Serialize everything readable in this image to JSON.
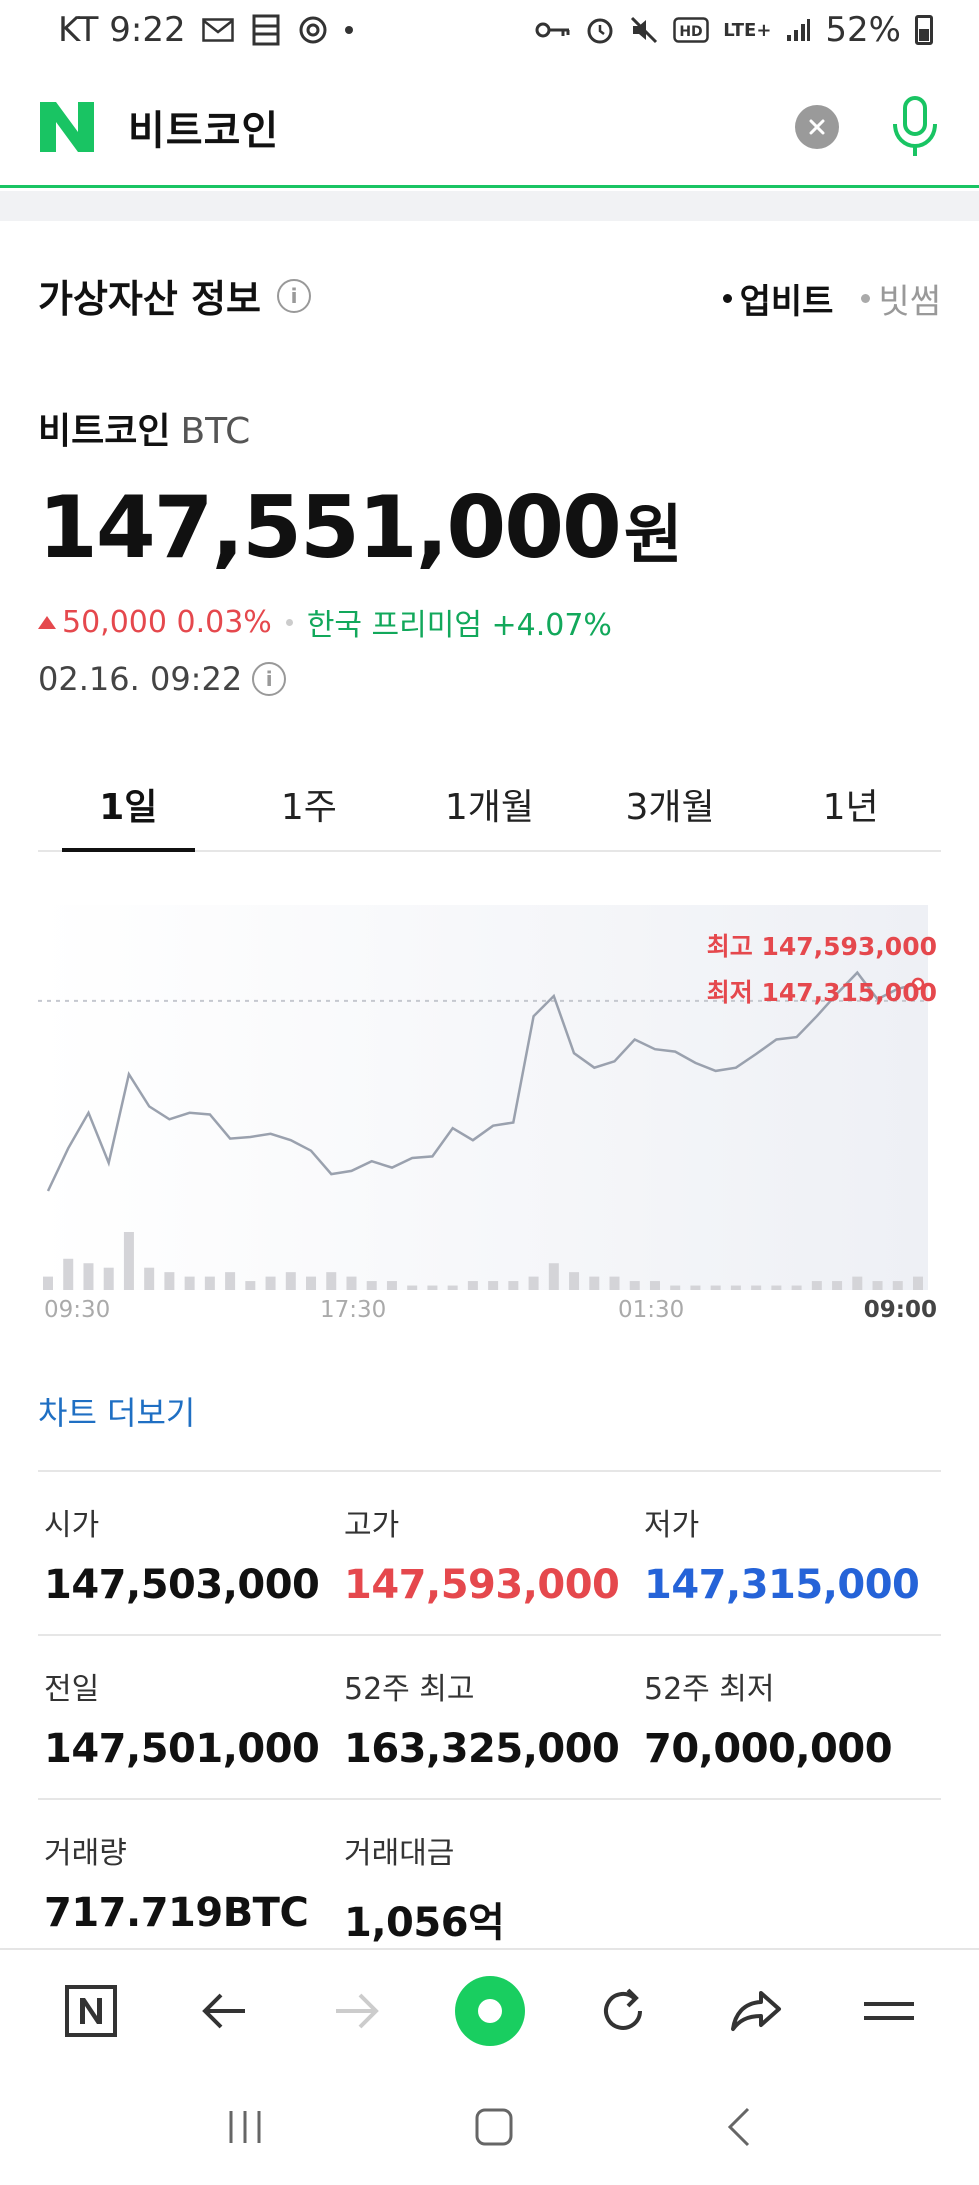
{
  "status_bar": {
    "carrier_time": "KT 9:22",
    "battery": "52%",
    "network": "LTE+",
    "icons": [
      "mail-icon",
      "gallery-icon",
      "chrome-icon",
      "dot-icon",
      "key-icon",
      "alarm-icon",
      "mute-icon",
      "hd-icon",
      "lte-icon",
      "signal-icon",
      "battery-icon"
    ]
  },
  "search": {
    "query": "비트코인",
    "logo_letter": "N",
    "brand_color": "#19c463"
  },
  "info": {
    "title": "가상자산 정보",
    "exchanges": [
      {
        "label": "업비트",
        "active": true
      },
      {
        "label": "빗썸",
        "active": false
      }
    ],
    "coin_kr": "비트코인",
    "coin_symbol": "BTC",
    "price": "147,551,000",
    "price_unit": "원",
    "change": "50,000 0.03%",
    "premium": "한국 프리미엄 +4.07%",
    "timestamp": "02.16. 09:22"
  },
  "tabs": [
    "1일",
    "1주",
    "1개월",
    "3개월",
    "1년"
  ],
  "chart_data": {
    "type": "line",
    "title": "",
    "x_labels": [
      "09:30",
      "17:30",
      "01:30",
      "09:00"
    ],
    "high_label": "최고 147,593,000",
    "low_label": "최저 147,315,000",
    "reference_line": 147551000,
    "ylim": [
      147315000,
      147593000
    ],
    "values": [
      147315000,
      147368000,
      147412000,
      147350000,
      147460000,
      147420000,
      147404000,
      147412000,
      147410000,
      147380000,
      147382000,
      147386000,
      147378000,
      147365000,
      147336000,
      147340000,
      147352000,
      147344000,
      147356000,
      147358000,
      147393000,
      147378000,
      147396000,
      147400000,
      147532000,
      147557000,
      147486000,
      147468000,
      147476000,
      147503000,
      147491000,
      147488000,
      147474000,
      147464000,
      147468000,
      147485000,
      147503000,
      147506000,
      147532000,
      147560000,
      147586000,
      147553000,
      147566000,
      147572000
    ],
    "volume": [
      3,
      7,
      6,
      5,
      13,
      5,
      4,
      3,
      3,
      4,
      2,
      3,
      4,
      3,
      4,
      3,
      2,
      2,
      1,
      1,
      1,
      2,
      2,
      2,
      3,
      6,
      4,
      3,
      3,
      2,
      2,
      1,
      1,
      1,
      1,
      1,
      1,
      1,
      2,
      2,
      3,
      2,
      2,
      3
    ]
  },
  "chart_more": "차트 더보기",
  "stats": [
    [
      {
        "label": "시가",
        "value": "147,503,000",
        "tone": "default"
      },
      {
        "label": "고가",
        "value": "147,593,000",
        "tone": "red"
      },
      {
        "label": "저가",
        "value": "147,315,000",
        "tone": "blue"
      }
    ],
    [
      {
        "label": "전일",
        "value": "147,501,000",
        "tone": "default"
      },
      {
        "label": "52주 최고",
        "value": "163,325,000",
        "tone": "default"
      },
      {
        "label": "52주 최저",
        "value": "70,000,000",
        "tone": "default"
      }
    ],
    [
      {
        "label": "거래량",
        "value": "717.719BTC",
        "tone": "default"
      },
      {
        "label": "거래대금",
        "value": "1,056억",
        "tone": "default"
      }
    ]
  ],
  "toolbar": {
    "icons": [
      "naver-home-icon",
      "back-arrow-icon",
      "forward-arrow-icon",
      "green-dot-icon",
      "refresh-icon",
      "share-icon",
      "menu-icon"
    ]
  },
  "colors": {
    "up": "#e5484d",
    "down": "#2563d8",
    "premium": "#12a85b",
    "link": "#1f6fc3"
  }
}
